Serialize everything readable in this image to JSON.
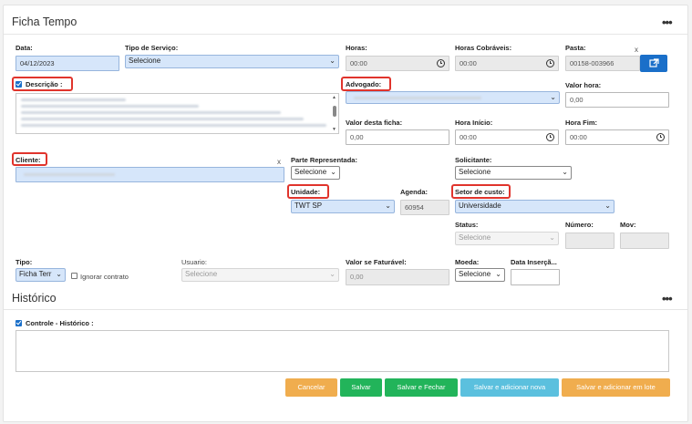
{
  "section1": {
    "title": "Ficha Tempo",
    "menu": "•••"
  },
  "labels": {
    "data": "Data:",
    "tipo_servico": "Tipo de Serviço:",
    "horas": "Horas:",
    "horas_cobraveis": "Horas Cobráveis:",
    "pasta": "Pasta:",
    "descricao": "Descrição :",
    "advogado": "Advogado:",
    "valor_hora": "Valor hora:",
    "valor_ficha": "Valor desta ficha:",
    "hora_inicio": "Hora Início:",
    "hora_fim": "Hora Fim:",
    "cliente": "Cliente:",
    "parte": "Parte Representada:",
    "solicitante": "Solicitante:",
    "unidade": "Unidade:",
    "agenda": "Agenda:",
    "setor": "Setor de custo:",
    "status": "Status:",
    "numero": "Número:",
    "mov": "Mov:",
    "tipo": "Tipo:",
    "ignorar": "Ignorar contrato",
    "usuario": "Usuario:",
    "valor_faturavel": "Valor se Faturável:",
    "moeda": "Moeda:",
    "data_insercao": "Data Inserçã..."
  },
  "values": {
    "data": "04/12/2023",
    "tipo_servico": "Selecione",
    "horas": "00:00",
    "horas_cobraveis": "00:00",
    "pasta": "00158-003966",
    "valor_hora": "0,00",
    "valor_ficha": "0,00",
    "hora_inicio": "00:00",
    "hora_fim": "00:00",
    "parte": "Selecione",
    "solicitante": "Selecione",
    "unidade": "TWT SP",
    "agenda": "60954",
    "setor": "Universidade",
    "status": "Selecione",
    "tipo": "Ficha Terr",
    "usuario": "Selecione",
    "valor_faturavel": "0,00",
    "moeda": "Selecione"
  },
  "close_x": "x",
  "section2": {
    "title": "Histórico",
    "menu": "•••",
    "controle_label": "Controle - Histórico :"
  },
  "buttons": {
    "cancelar": "Cancelar",
    "salvar": "Salvar",
    "salvar_fechar": "Salvar e Fechar",
    "salvar_nova": "Salvar e adicionar nova",
    "salvar_lote": "Salvar e adicionar em lote"
  },
  "colors": {
    "highlight": "#e0342c",
    "primary": "#1a6fc9",
    "cancel": "#f0ad4e",
    "save": "#22b45a",
    "info": "#5bc0de"
  },
  "icons": {
    "pasta_button": "external-link-icon",
    "time": "clock-icon"
  }
}
